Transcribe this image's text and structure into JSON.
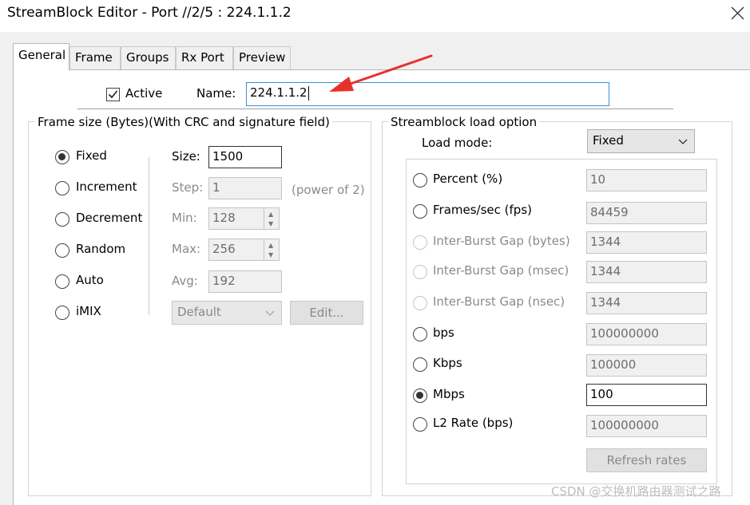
{
  "window": {
    "title": "StreamBlock Editor - Port //2/5 : 224.1.1.2"
  },
  "tabs": [
    "General",
    "Frame",
    "Groups",
    "Rx Port",
    "Preview"
  ],
  "general": {
    "active_label": "Active",
    "active_checked": true,
    "name_label": "Name:",
    "name_value": "224.1.1.2"
  },
  "frame_size": {
    "group_title": "Frame size (Bytes)(With CRC and signature field)",
    "modes": [
      "Fixed",
      "Increment",
      "Decrement",
      "Random",
      "Auto",
      "iMIX"
    ],
    "selected_mode": "Fixed",
    "size_label": "Size:",
    "size_value": "1500",
    "step_label": "Step:",
    "step_value": "1",
    "step_hint": "(power of 2)",
    "min_label": "Min:",
    "min_value": "128",
    "max_label": "Max:",
    "max_value": "256",
    "avg_label": "Avg:",
    "avg_value": "192",
    "imix_profile": "Default",
    "edit_button": "Edit..."
  },
  "load_option": {
    "group_title": "Streamblock load option",
    "load_mode_label": "Load mode:",
    "load_mode_value": "Fixed",
    "options": [
      {
        "label": "Percent (%)",
        "value": "10",
        "enabled": true
      },
      {
        "label": "Frames/sec (fps)",
        "value": "84459",
        "enabled": true
      },
      {
        "label": "Inter-Burst Gap (bytes)",
        "value": "1344",
        "enabled": false
      },
      {
        "label": "Inter-Burst Gap (msec)",
        "value": "1344",
        "enabled": false
      },
      {
        "label": "Inter-Burst Gap (nsec)",
        "value": "1344",
        "enabled": false
      },
      {
        "label": "bps",
        "value": "100000000",
        "enabled": true
      },
      {
        "label": "Kbps",
        "value": "100000",
        "enabled": true
      },
      {
        "label": "Mbps",
        "value": "100",
        "enabled": true
      },
      {
        "label": "L2 Rate (bps)",
        "value": "100000000",
        "enabled": true
      }
    ],
    "selected_option": "Mbps",
    "refresh_button": "Refresh rates"
  },
  "watermark": "CSDN @交换机路由器测试之路",
  "colors": {
    "annotation_arrow": "#e8302a",
    "name_focus_border": "#3a8fd6"
  }
}
